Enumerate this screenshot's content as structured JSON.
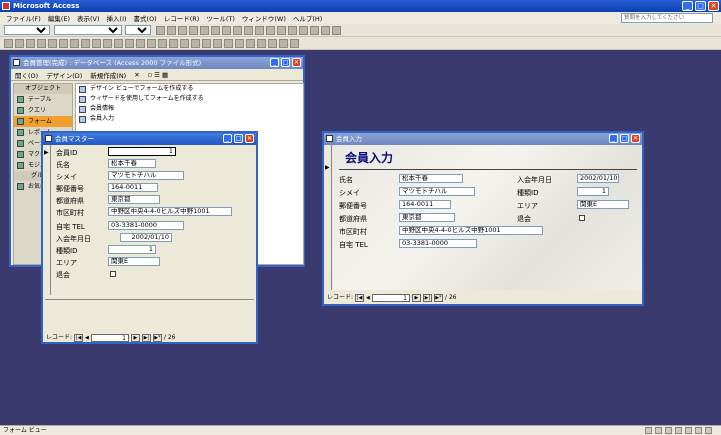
{
  "app": {
    "title": "Microsoft Access",
    "help_placeholder": "質問を入力してください"
  },
  "menu": [
    "ファイル(F)",
    "編集(E)",
    "表示(V)",
    "挿入(I)",
    "書式(O)",
    "レコード(R)",
    "ツール(T)",
    "ウィンドウ(W)",
    "ヘルプ(H)"
  ],
  "db_window": {
    "title": "会員管理(完成) : データベース (Access 2000 ファイル形式)",
    "toolbar": [
      "開く(O)",
      "デザイン(D)",
      "新規作成(N)"
    ],
    "objects_header": "オブジェクト",
    "objects": [
      "テーブル",
      "クエリ",
      "フォーム",
      "レポート",
      "ページ",
      "マクロ",
      "モジュール"
    ],
    "groups_header": "グループ",
    "favorites": "お気に入り",
    "items": [
      "デザイン ビューでフォームを作成する",
      "ウィザードを使用してフォームを作成する",
      "会員情報",
      "会員入力"
    ]
  },
  "member_master": {
    "title": "会員マスター",
    "labels": [
      "会員ID",
      "氏名",
      "シメイ",
      "郵便番号",
      "都道府県",
      "市区町村",
      "自宅 TEL",
      "入会年月日",
      "種類ID",
      "エリア",
      "退会"
    ],
    "values": [
      "1",
      "松本千春",
      "マツモトチハル",
      "164-0011",
      "東京都",
      "中野区中央4-4-0ヒルズ中野1001",
      "03-3381-0000",
      "2002/01/10",
      "1",
      "関東E"
    ],
    "record_label": "レコード:",
    "record_current": "1",
    "record_total": "26"
  },
  "member_input": {
    "title": "会員入力",
    "heading": "会員入力",
    "labels_left": [
      "氏名",
      "シメイ",
      "郵便番号",
      "都道府県",
      "市区町村",
      "自宅 TEL"
    ],
    "values_left": [
      "松本千春",
      "マツモトチハル",
      "164-0011",
      "東京都",
      "中野区中央4-4-0ヒルズ中野1001",
      "03-3381-0000"
    ],
    "labels_right": [
      "入会年月日",
      "種類ID",
      "エリア",
      "退会"
    ],
    "values_right": [
      "2002/01/10",
      "1",
      "関東E"
    ],
    "record_label": "レコード:",
    "record_current": "1",
    "record_total": "26"
  },
  "status": {
    "text": "フォーム ビュー"
  }
}
